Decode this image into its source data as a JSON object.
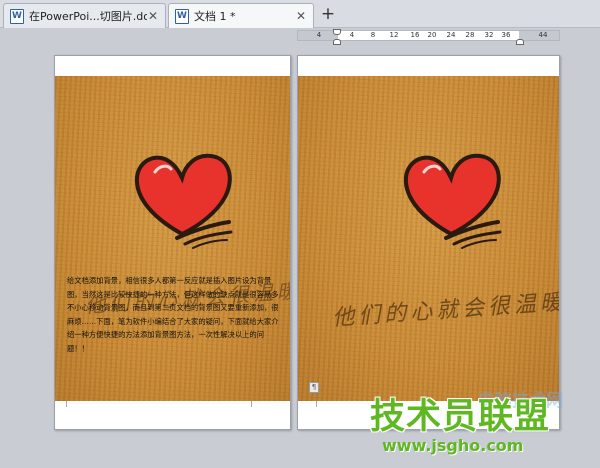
{
  "tabs": [
    {
      "label": "在PowerPoi...切图片.doc *",
      "active": false
    },
    {
      "label": "文档 1 *",
      "active": true
    }
  ],
  "tab_close_symbol": "✕",
  "tab_add_symbol": "+",
  "ruler": {
    "labels": [
      "4",
      "4",
      "8",
      "12",
      "16",
      "20",
      "24",
      "28",
      "32",
      "36",
      "44"
    ]
  },
  "left_page": {
    "handwriting": "他们的心就会很温暖",
    "body_text": "给文档添加背景，相信很多人都第一反应就是插入图片设为背景图，当然这是比较快捷的一种方法，但这样做的缺点就是很容易多不小心移动背景图，而且到第二页文档的背景图又要重新添加，很麻烦……下面，笔为软件小编结合了大家的疑问，下面就给大家介绍一种方便快捷的方法添加背景图方法，一次性解决以上的问题！！"
  },
  "right_page": {
    "handwriting": "他们的心就会很温暖"
  },
  "watermark": {
    "main": "技术员联盟",
    "url": "www.jsgho.com",
    "faint": "电脑技术网"
  },
  "colors": {
    "heart": "#e8322c",
    "wood": "#c98a35",
    "watermark": "#5fb821"
  }
}
